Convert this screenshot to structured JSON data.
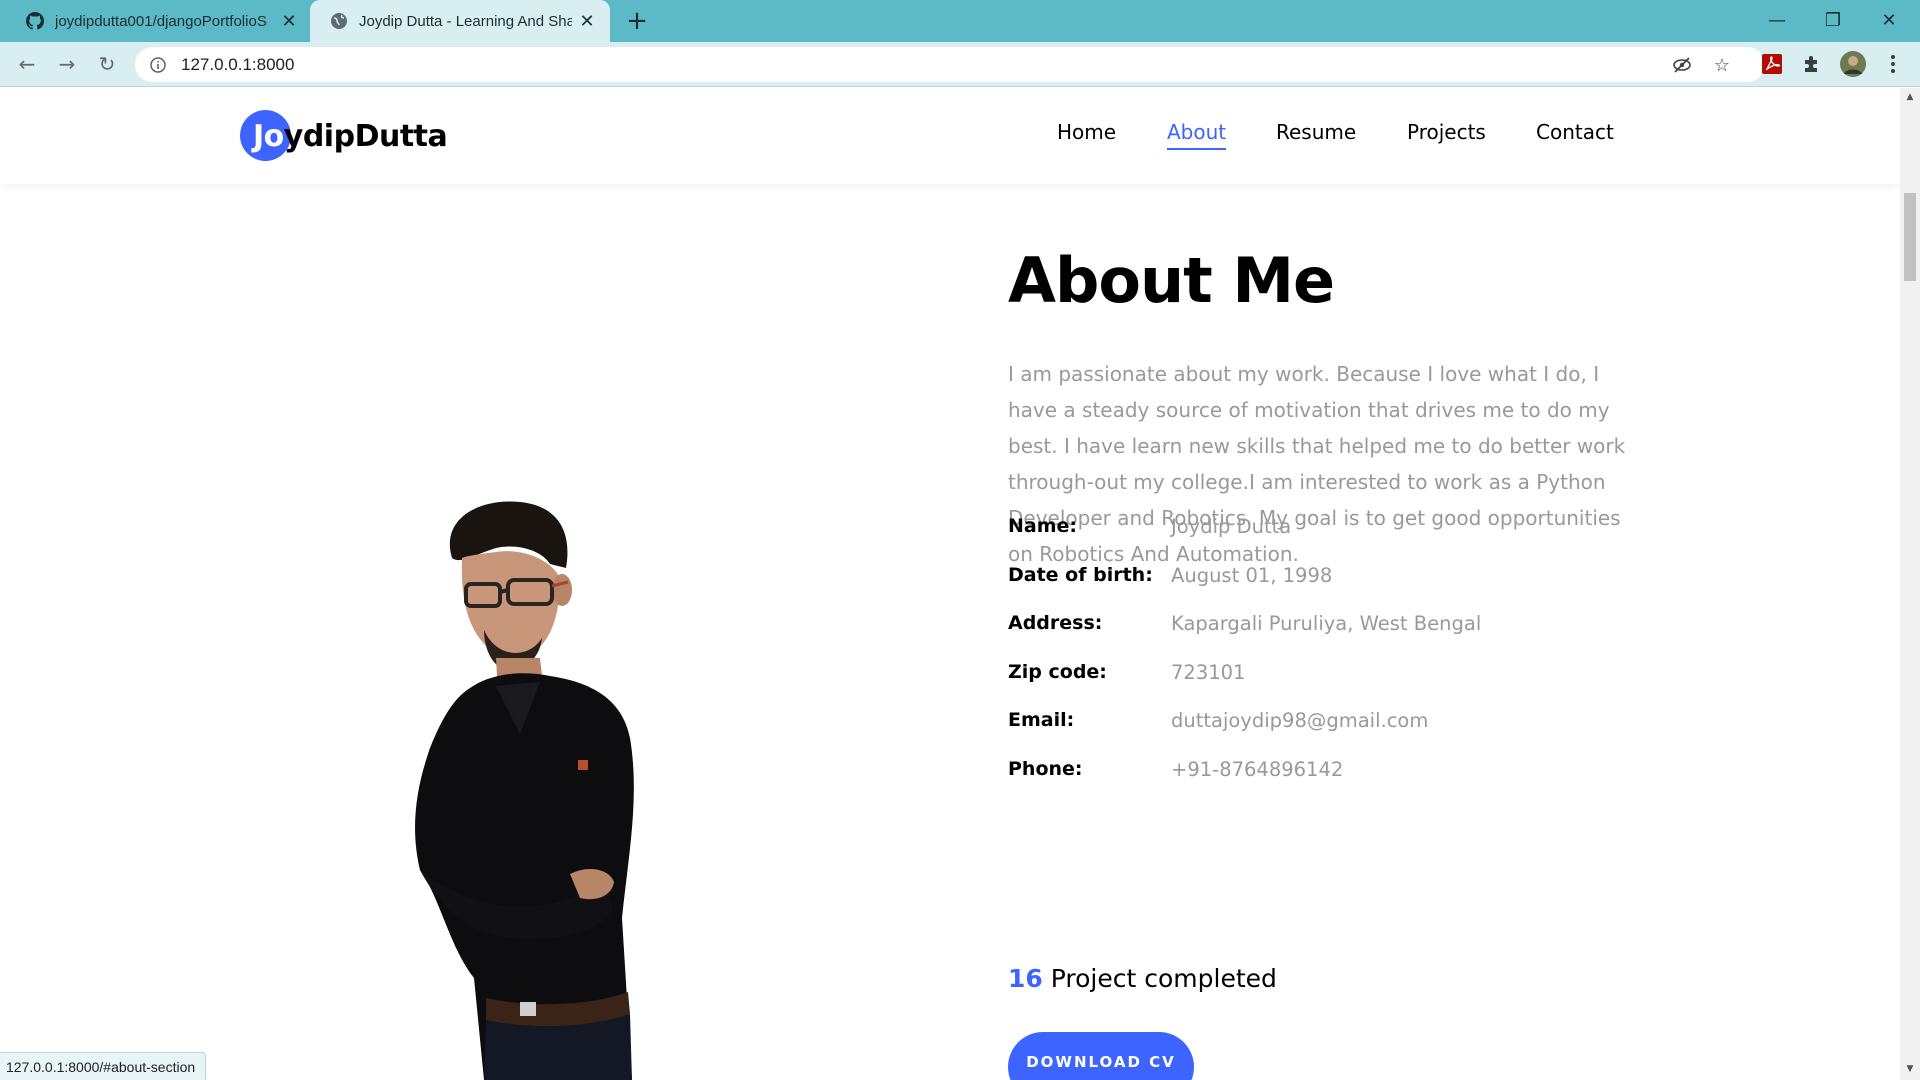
{
  "browser": {
    "tabs": [
      {
        "title": "joydipdutta001/djangoPortfolioS",
        "icon": "github-icon",
        "active": false
      },
      {
        "title": "Joydip Dutta - Learning And Shar",
        "icon": "globe-icon",
        "active": true
      }
    ],
    "address": "127.0.0.1:8000",
    "status_url": "127.0.0.1:8000/#about-section"
  },
  "site": {
    "logo": {
      "highlight": "Jo",
      "rest": "ydipDutta"
    },
    "nav": [
      "Home",
      "About",
      "Resume",
      "Projects",
      "Contact"
    ],
    "active_nav": "About",
    "accent_color": "#3e64ff"
  },
  "about": {
    "title": "About Me",
    "paragraph": "I am passionate about my work. Because I love what I do, I have a steady source of motivation that drives me to do my best. I have learn new skills that helped me to do better work through-out my college.I am interested to work as a Python Developer and Robotics. My goal is to get good opportunities on Robotics And Automation.",
    "info": [
      {
        "label": "Name:",
        "value": "Joydip Dutta"
      },
      {
        "label": "Date of birth:",
        "value": "August 01, 1998"
      },
      {
        "label": "Address:",
        "value": "Kapargali Puruliya, West Bengal"
      },
      {
        "label": "Zip code:",
        "value": "723101"
      },
      {
        "label": "Email:",
        "value": "duttajoydip98@gmail.com"
      },
      {
        "label": "Phone:",
        "value": "+91-8764896142"
      }
    ],
    "counter": {
      "number": "16",
      "label": "Project completed"
    },
    "cv_button": "DOWNLOAD CV"
  }
}
